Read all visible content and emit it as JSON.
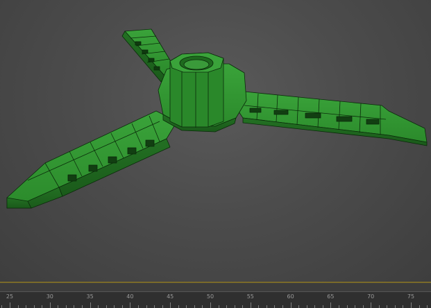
{
  "viewport": {
    "background": "#4c4c4c",
    "model_color": "#2e8b2e",
    "model_edge_color": "#0a2a0a"
  },
  "timeline": {
    "accent_color": "#7a6a2a",
    "ticks": [
      {
        "label": "25",
        "value": 25
      },
      {
        "label": "30",
        "value": 30
      },
      {
        "label": "35",
        "value": 35
      },
      {
        "label": "40",
        "value": 40
      },
      {
        "label": "45",
        "value": 45
      },
      {
        "label": "50",
        "value": 50
      },
      {
        "label": "55",
        "value": 55
      },
      {
        "label": "60",
        "value": 60
      },
      {
        "label": "65",
        "value": 65
      },
      {
        "label": "70",
        "value": 70
      },
      {
        "label": "75",
        "value": 75
      }
    ]
  }
}
